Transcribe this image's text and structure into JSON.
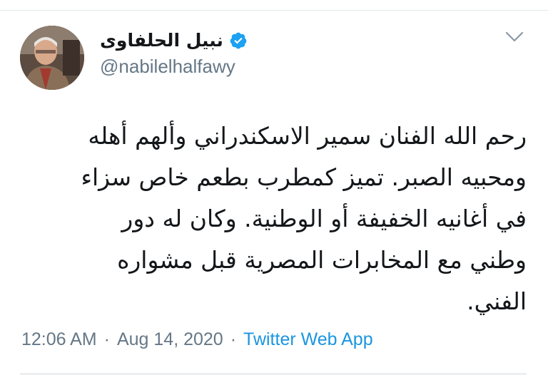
{
  "author": {
    "display_name": "نبيل الحلفاوى",
    "handle": "@nabilelhalfawy",
    "verified": true
  },
  "tweet": {
    "lines": [
      "رحم الله الفنان سمير الاسكندراني وألهم أهله",
      "ومحبيه الصبر. تميز كمطرب بطعم خاص سزاء",
      "في أغانيه الخفيفة أو الوطنية. وكان له دور",
      "وطني مع المخابرات المصرية قبل مشواره",
      "الفني."
    ]
  },
  "meta": {
    "time": "12:06 AM",
    "separator": "·",
    "date": "Aug 14, 2020",
    "source": "Twitter Web App"
  },
  "colors": {
    "verified": "#1da1f2",
    "link": "#1b95e0",
    "muted": "#657786"
  },
  "icons": {
    "verified": "verified-badge-icon",
    "menu": "chevron-down-icon"
  }
}
